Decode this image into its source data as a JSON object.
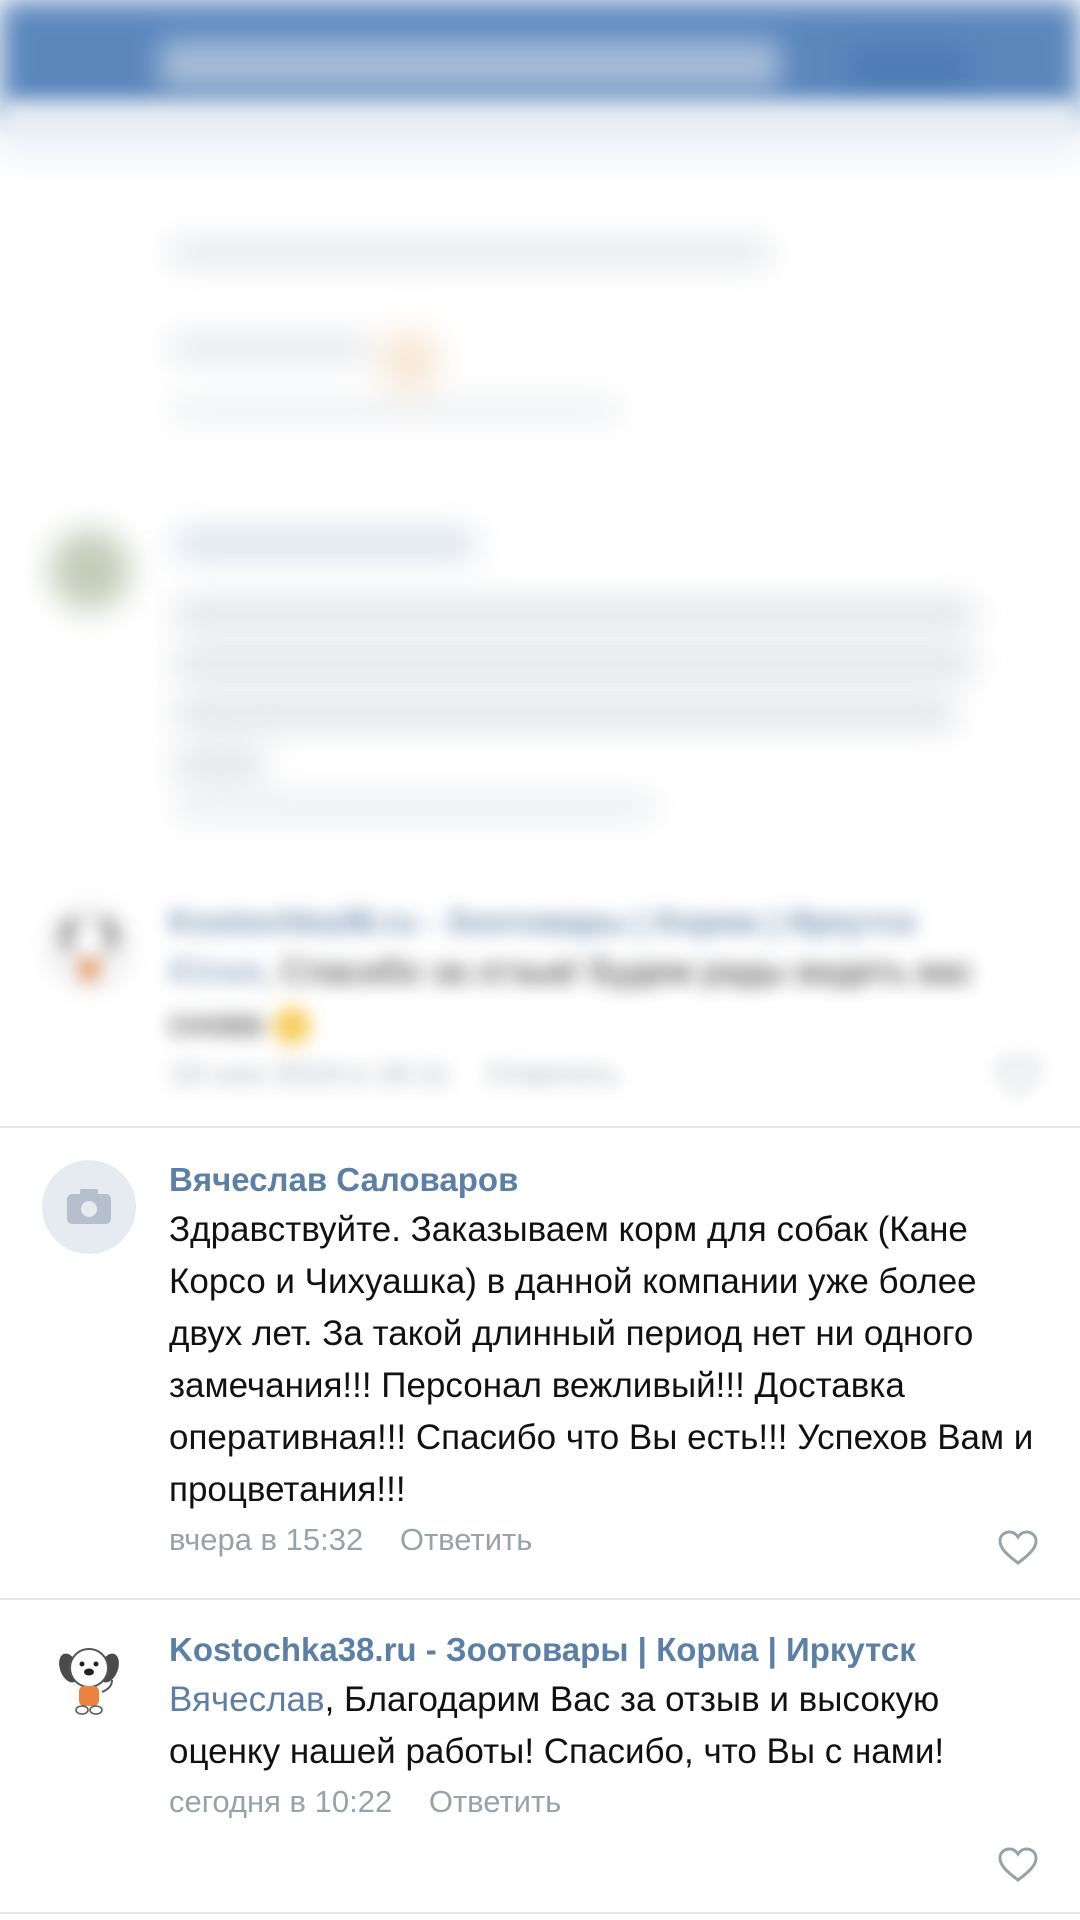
{
  "comments": [
    {
      "reply_label": "Ответить"
    },
    {
      "author": "Kostochka38.ru - Зоотовары | Корма | Иркутск",
      "mention": "Юлия",
      "text": ", Спасибо за отзыв! Будем рады видеть вас снова",
      "time": "19 ноя 2019 в 18:11",
      "reply_label": "Ответить"
    },
    {
      "author": "Вячеслав Саловаров",
      "text": "Здравствуйте. Заказываем корм для собак (Кане Корсо и Чихуашка) в данной компании уже более двух лет. За такой длинный период нет ни одного замечания!!! Персонал вежливый!!! Доставка оперативная!!! Спасибо что Вы есть!!! Успехов Вам и процветания!!!",
      "time": "вчера в 15:32",
      "reply_label": "Ответить"
    },
    {
      "author": "Kostochka38.ru - Зоотовары | Корма | Иркутск",
      "mention": "Вячеслав",
      "text": ", Благодарим Вас за отзыв и высокую оценку нашей работы! Спасибо, что Вы с нами!",
      "time": "сегодня в 10:22",
      "reply_label": "Ответить"
    }
  ],
  "colors": {
    "link": "#5c7fa6",
    "meta": "#9aa1a9",
    "topbar": "#5b87bd"
  },
  "icons": {
    "like": "heart-icon",
    "no_photo": "camera-icon",
    "brand_avatar": "dog-mascot-icon"
  }
}
